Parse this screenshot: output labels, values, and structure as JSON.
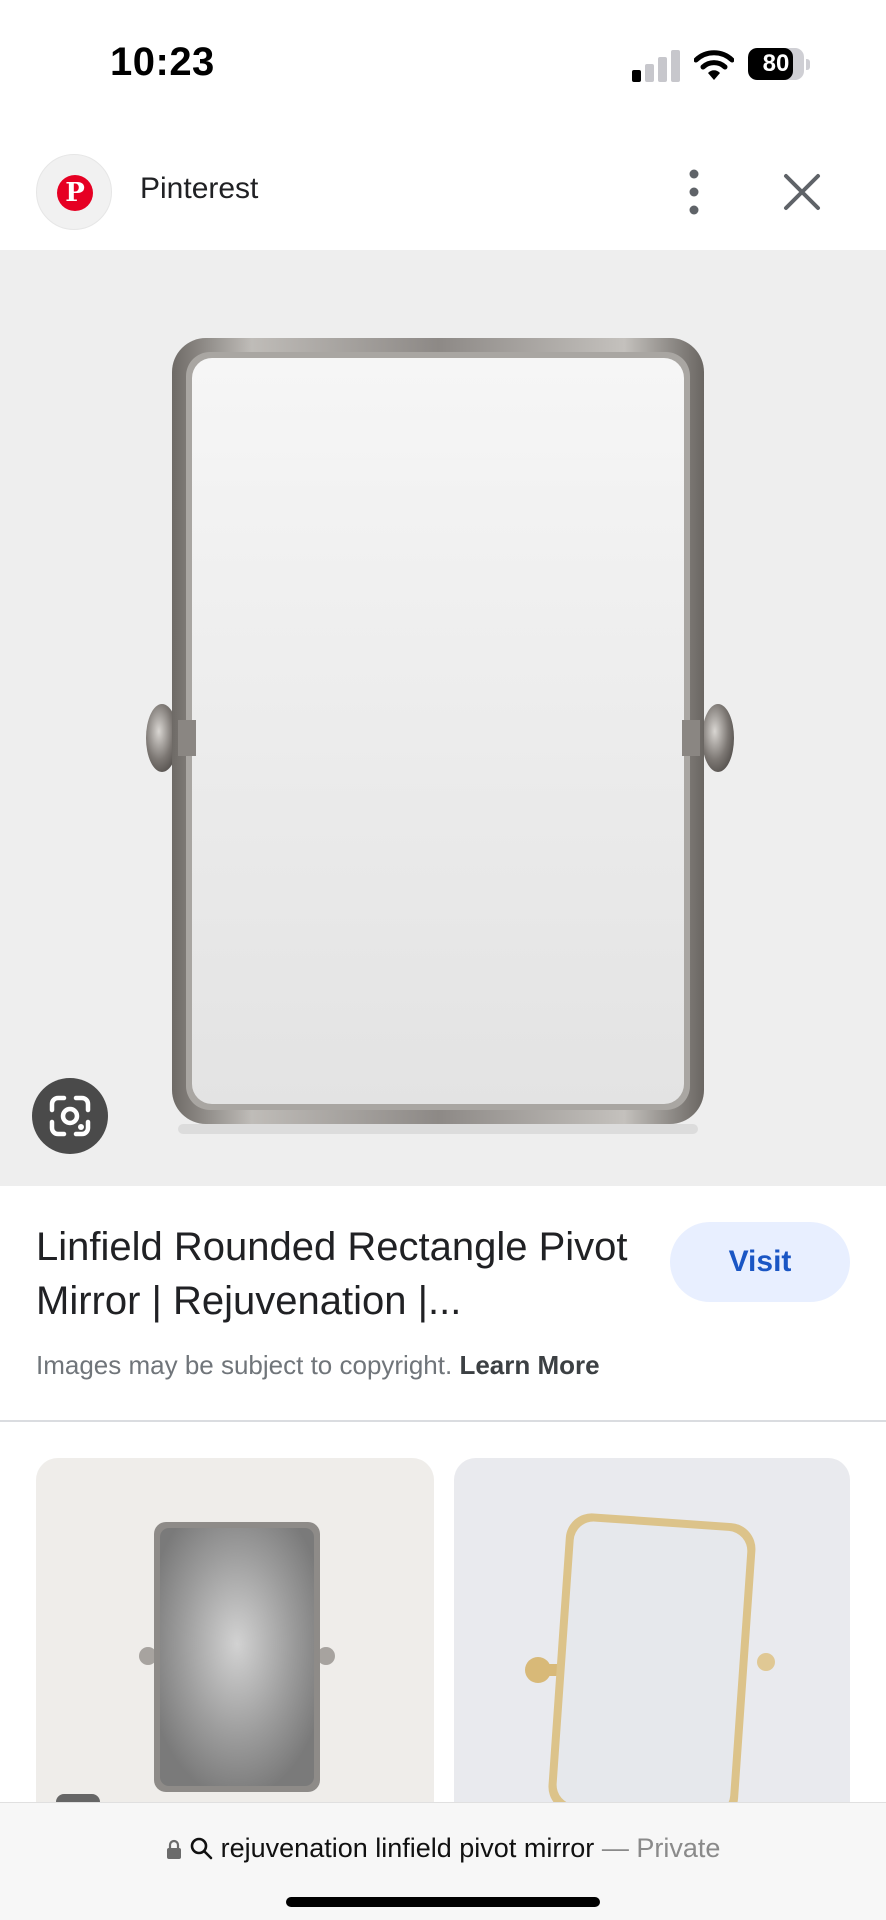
{
  "status_bar": {
    "time": "10:23",
    "battery": "80",
    "battery_level": 0.8,
    "signal_bars_active": 1,
    "signal_bars_total": 4
  },
  "header": {
    "source_name": "Pinterest",
    "source_logo_letter": "P",
    "brand_color": "#e60023"
  },
  "result": {
    "title": "Linfield Rounded Rectangle Pivot Mirror | Rejuvenation |...",
    "visit_label": "Visit",
    "copyright_text": "Images may be subject to copyright.",
    "learn_more_label": "Learn More"
  },
  "url_bar": {
    "query": "rejuvenation linfield pivot mirror",
    "separator": " — ",
    "mode": "Private"
  },
  "colors": {
    "accent": "#1a56c4",
    "visit_bg": "#e8efff",
    "image_bg": "#eeeeee"
  },
  "icons": [
    "lock-icon",
    "search-icon",
    "lens-icon",
    "more-vert-icon",
    "close-icon",
    "wifi-icon",
    "signal-icon",
    "battery-icon"
  ]
}
